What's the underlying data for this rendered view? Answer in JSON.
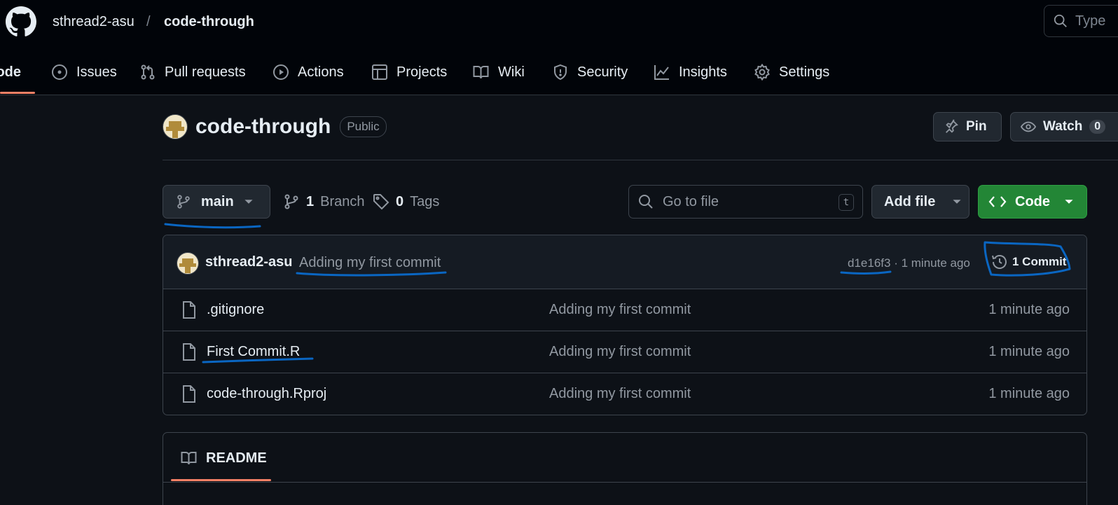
{
  "breadcrumb": {
    "owner": "sthread2-asu",
    "separator": "/",
    "repo": "code-through"
  },
  "search": {
    "placeholder": "Type"
  },
  "tabs": [
    {
      "label": "Code",
      "icon": "code-icon",
      "active": true
    },
    {
      "label": "Issues",
      "icon": "issue-icon"
    },
    {
      "label": "Pull requests",
      "icon": "pull-request-icon"
    },
    {
      "label": "Actions",
      "icon": "play-icon"
    },
    {
      "label": "Projects",
      "icon": "table-icon"
    },
    {
      "label": "Wiki",
      "icon": "book-icon"
    },
    {
      "label": "Security",
      "icon": "shield-icon"
    },
    {
      "label": "Insights",
      "icon": "graph-icon"
    },
    {
      "label": "Settings",
      "icon": "gear-icon"
    }
  ],
  "repo": {
    "name": "code-through",
    "visibility": "Public"
  },
  "actions": {
    "pin": "Pin",
    "watch": "Watch",
    "watch_count": "0"
  },
  "branch": {
    "current": "main",
    "branch_count": "1",
    "branch_label": "Branch",
    "tag_count": "0",
    "tag_label": "Tags"
  },
  "file_search": {
    "placeholder": "Go to file",
    "shortcut": "t"
  },
  "add_file": "Add file",
  "code_button": "Code",
  "latest_commit": {
    "author": "sthread2-asu",
    "message": "Adding my first commit",
    "sha": "d1e16f3",
    "separator": "·",
    "time": "1 minute ago",
    "count_label": "1 Commit"
  },
  "files": [
    {
      "name": ".gitignore",
      "message": "Adding my first commit",
      "time": "1 minute ago"
    },
    {
      "name": "First Commit.R",
      "message": "Adding my first commit",
      "time": "1 minute ago"
    },
    {
      "name": "code-through.Rproj",
      "message": "Adding my first commit",
      "time": "1 minute ago"
    }
  ],
  "readme": {
    "label": "README"
  },
  "colors": {
    "accent_underline": "#f78166",
    "code_button": "#238636",
    "annotation": "#0a66c2"
  }
}
